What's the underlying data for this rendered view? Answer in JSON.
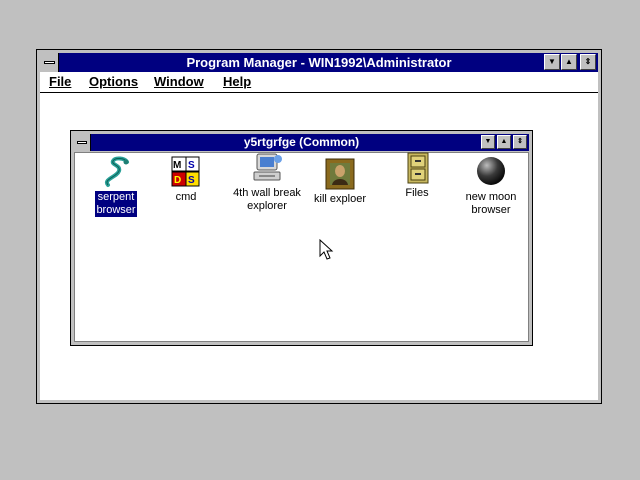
{
  "program_manager": {
    "title": "Program Manager - WIN1992\\Administrator",
    "menu": [
      {
        "label": "File"
      },
      {
        "label": "Options"
      },
      {
        "label": "Window"
      },
      {
        "label": "Help"
      }
    ],
    "buttons": {
      "minimize": "▼",
      "maximize": "▲",
      "restore": "⇕"
    }
  },
  "group_window": {
    "title": "y5rtgrfge (Common)",
    "items": [
      {
        "label_line1": "serpent",
        "label_line2": "browser",
        "icon": "serpent-icon",
        "selected": true
      },
      {
        "label_line1": "cmd",
        "label_line2": "",
        "icon": "msdos-icon",
        "selected": false
      },
      {
        "label_line1": "4th wall break",
        "label_line2": "explorer",
        "icon": "computer-icon",
        "selected": false
      },
      {
        "label_line1": "kill exploer",
        "label_line2": "",
        "icon": "portrait-icon",
        "selected": false
      },
      {
        "label_line1": "Files",
        "label_line2": "",
        "icon": "file-cabinet-icon",
        "selected": false
      },
      {
        "label_line1": "new moon",
        "label_line2": "browser",
        "icon": "moon-icon",
        "selected": false
      }
    ]
  },
  "colors": {
    "titlebar": "#000080",
    "desktop": "#c0c0c0",
    "selection": "#000080"
  }
}
